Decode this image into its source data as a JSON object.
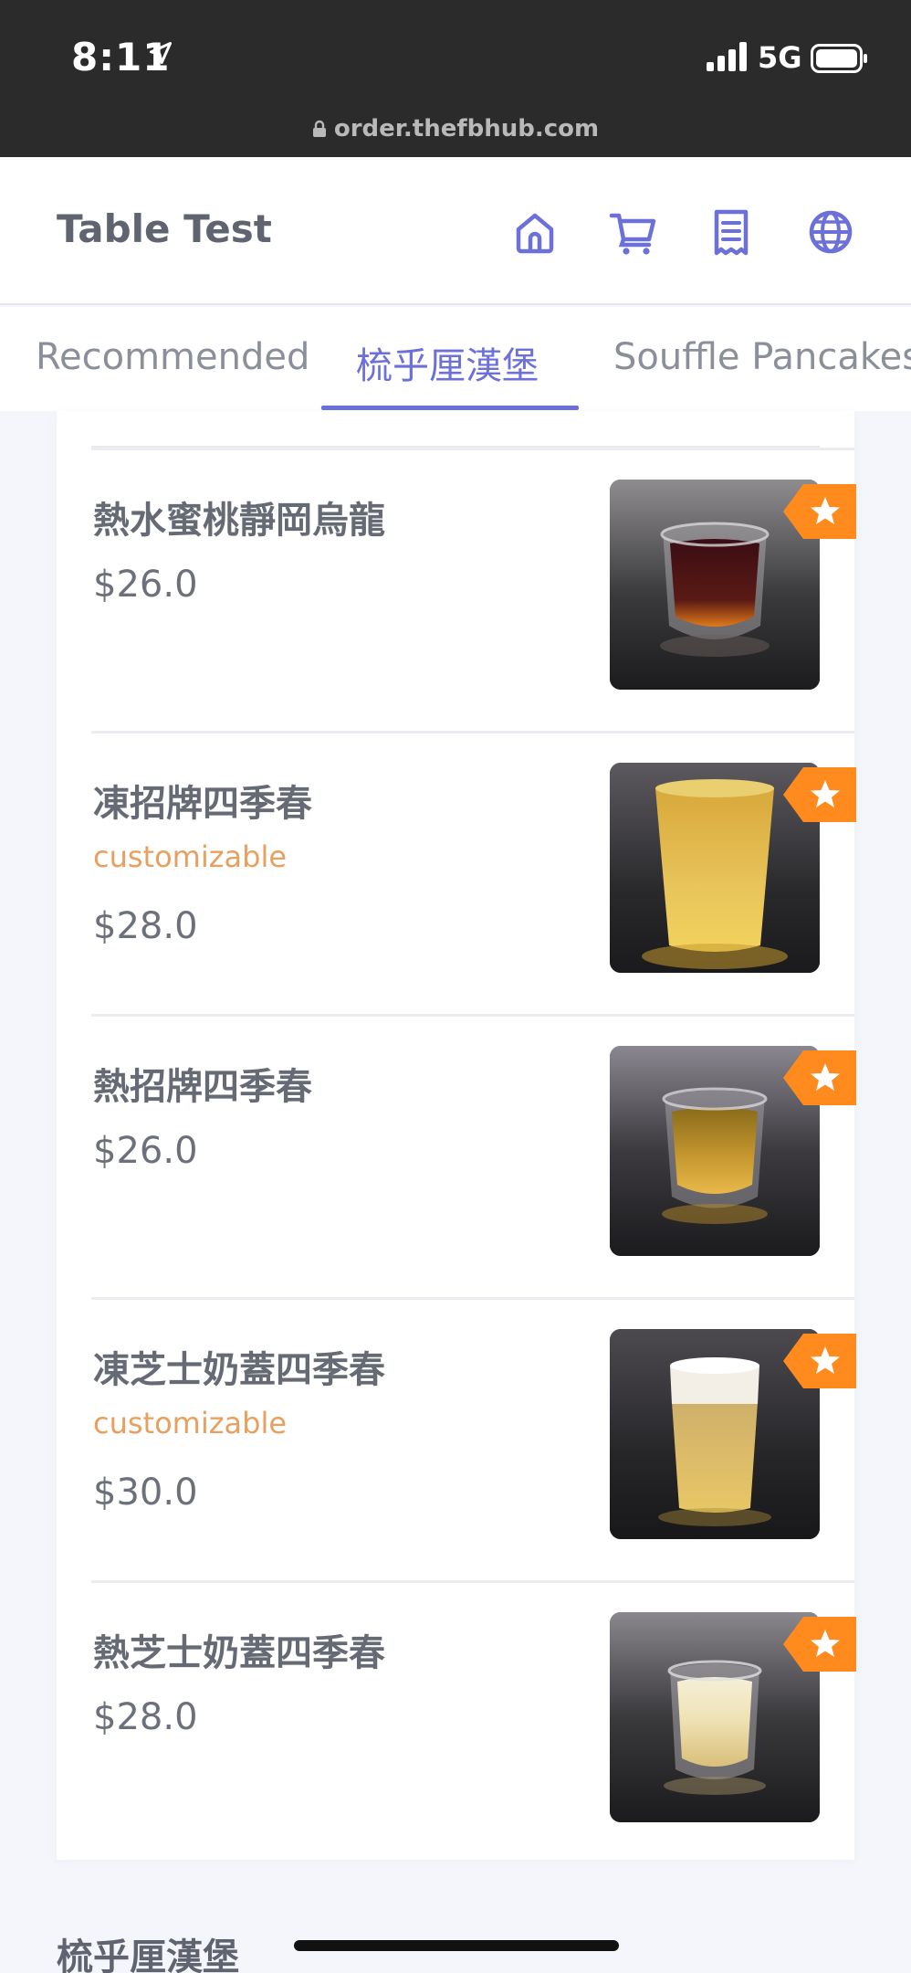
{
  "status_bar": {
    "time": "8:11",
    "network": "5G",
    "url": "order.thefbhub.com"
  },
  "header": {
    "title": "Table Test",
    "icons": [
      "home-icon",
      "cart-icon",
      "receipt-icon",
      "globe-icon"
    ],
    "accent": "#6c70d9"
  },
  "tabs": [
    {
      "label": "Recommended",
      "active": false
    },
    {
      "label": "梳乎厘漢堡",
      "active": true
    },
    {
      "label": "Souffle Pancakes",
      "active": false
    }
  ],
  "items": [
    {
      "name": "熱水蜜桃靜岡烏龍",
      "customizable": "",
      "price": "$26.0",
      "drink": "dark-tea",
      "starred": true
    },
    {
      "name": "凍招牌四季春",
      "customizable": "customizable",
      "price": "$28.0",
      "drink": "iced-gold",
      "starred": true
    },
    {
      "name": "熱招牌四季春",
      "customizable": "",
      "price": "$26.0",
      "drink": "hot-gold",
      "starred": true
    },
    {
      "name": "凍芝士奶蓋四季春",
      "customizable": "customizable",
      "price": "$30.0",
      "drink": "cheese-iced",
      "starred": true
    },
    {
      "name": "熱芝士奶蓋四季春",
      "customizable": "",
      "price": "$28.0",
      "drink": "cheese-hot",
      "starred": true
    }
  ],
  "section_title": "梳乎厘漢堡",
  "colors": {
    "customizable": "#e8a060",
    "star_badge": "#ff8a1e"
  }
}
